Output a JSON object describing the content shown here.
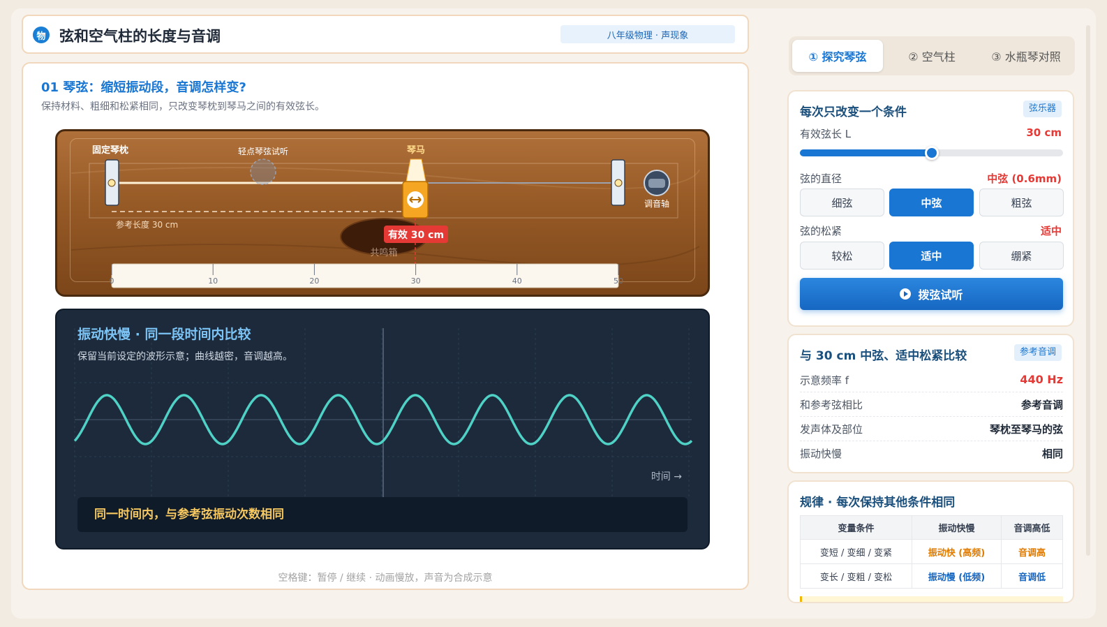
{
  "header": {
    "logo_char": "物",
    "title": "弦和空气柱的长度与音调",
    "badge": "八年级物理 · 声现象"
  },
  "section": {
    "title": "01 琴弦：缩短振动段，音调怎样变?",
    "subtitle": "保持材料、粗细和松紧相同，只改变琴枕到琴马之间的有效弦长。"
  },
  "instrument": {
    "nut_label": "固定琴枕",
    "tap_label": "轻点琴弦试听",
    "bridge_label": "琴马",
    "tuner_label": "调音轴",
    "reference_label": "参考长度 30 cm",
    "effective_tag": "有效 30 cm",
    "soundbox_label": "共鸣箱",
    "ruler_ticks": [
      "0",
      "10",
      "20",
      "30",
      "40",
      "50"
    ],
    "effective_length_cm": 30
  },
  "wave": {
    "title": "振动快慢 · 同一段时间内比较",
    "subtitle": "保留当前设定的波形示意；曲线越密，音调越高。",
    "time_label": "时间 →",
    "compare_text": "同一时间内，与参考弦振动次数相同",
    "cycles_shown": 8
  },
  "footer_hint": "空格键：暂停 / 继续 · 动画慢放，声音为合成示意",
  "tabs": [
    {
      "label": "① 探究琴弦",
      "active": true
    },
    {
      "label": "② 空气柱",
      "active": false
    },
    {
      "label": "③ 水瓶琴对照",
      "active": false
    }
  ],
  "controls": {
    "title": "每次只改变一个条件",
    "tag": "弦乐器",
    "length_label": "有效弦长 L",
    "length_value": "30 cm",
    "slider_fraction": 0.5,
    "diameter_label": "弦的直径",
    "diameter_value": "中弦 (0.6mm)",
    "diameter_options": [
      "细弦",
      "中弦",
      "粗弦"
    ],
    "diameter_selected": "中弦",
    "tension_label": "弦的松紧",
    "tension_value": "适中",
    "tension_options": [
      "较松",
      "适中",
      "绷紧"
    ],
    "tension_selected": "适中",
    "pluck_label": "拨弦试听"
  },
  "compare": {
    "title": "与 30 cm 中弦、适中松紧比较",
    "tag": "参考音调",
    "rows": [
      {
        "k": "示意频率 f",
        "v": "440 Hz"
      },
      {
        "k": "和参考弦相比",
        "v": "参考音调"
      },
      {
        "k": "发声体及部位",
        "v": "琴枕至琴马的弦"
      },
      {
        "k": "振动快慢",
        "v": "相同"
      }
    ]
  },
  "rules": {
    "title": "规律 · 每次保持其他条件相同",
    "headers": [
      "变量条件",
      "振动快慢",
      "音调高低"
    ],
    "rows": [
      [
        "变短 / 变细 / 变紧",
        "振动快 (高频)",
        "音调高"
      ],
      [
        "变长 / 变粗 / 变松",
        "振动慢 (低频)",
        "音调低"
      ]
    ]
  },
  "colors": {
    "accent": "#1976d2",
    "highlight_red": "#e53935",
    "wave": "#4fd1c5",
    "bridge": "#f5a623"
  }
}
